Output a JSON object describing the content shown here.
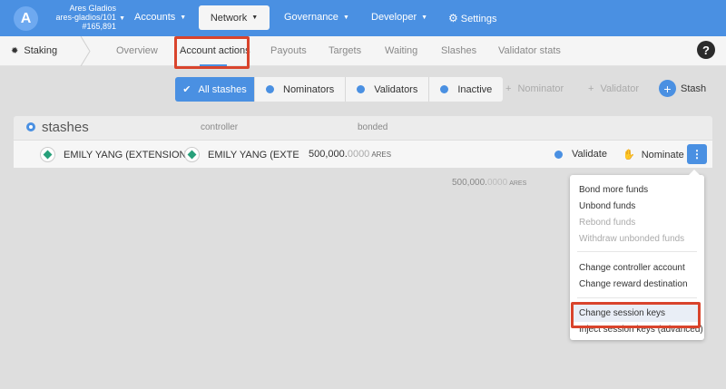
{
  "header": {
    "logo_letter": "A",
    "chain_name": "Ares Gladios",
    "chain_account": "ares-gladios/101",
    "chain_block": "#165,891",
    "nav": [
      {
        "label": "Accounts"
      },
      {
        "label": "Network"
      },
      {
        "label": "Governance"
      },
      {
        "label": "Developer"
      },
      {
        "label": "Settings"
      }
    ]
  },
  "subnav": {
    "section": "Staking",
    "tabs": [
      "Overview",
      "Account actions",
      "Payouts",
      "Targets",
      "Waiting",
      "Slashes",
      "Validator stats"
    ],
    "active_tab": "Account actions",
    "help_label": "?"
  },
  "filters": {
    "options": [
      "All stashes",
      "Nominators",
      "Validators",
      "Inactive"
    ],
    "selected": "All stashes"
  },
  "actions": {
    "add_nominator": "Nominator",
    "add_validator": "Validator",
    "add_stash": "Stash"
  },
  "table": {
    "title": "stashes",
    "columns": [
      "controller",
      "bonded"
    ],
    "rows": [
      {
        "stash": "EMILY YANG (EXTENSION",
        "controller": "EMILY YANG (EXTE",
        "bonded_int": "500,000.",
        "bonded_dec": "0000",
        "unit": "ARES",
        "validate": "Validate",
        "nominate": "Nominate"
      }
    ],
    "total_int": "500,000.",
    "total_dec": "0000",
    "total_unit": "ARES"
  },
  "menu": {
    "items": [
      {
        "label": "Bond more funds",
        "enabled": true
      },
      {
        "label": "Unbond funds",
        "enabled": true
      },
      {
        "label": "Rebond funds",
        "enabled": false
      },
      {
        "label": "Withdraw unbonded funds",
        "enabled": false
      },
      {
        "label": "Change controller account",
        "enabled": true
      },
      {
        "label": "Change reward destination",
        "enabled": true
      },
      {
        "label": "Change session keys",
        "enabled": true
      },
      {
        "label": "Inject session keys (advanced)",
        "enabled": true
      }
    ]
  },
  "colors": {
    "brand_blue": "#4a90e2",
    "highlight_red": "#d9442c"
  }
}
